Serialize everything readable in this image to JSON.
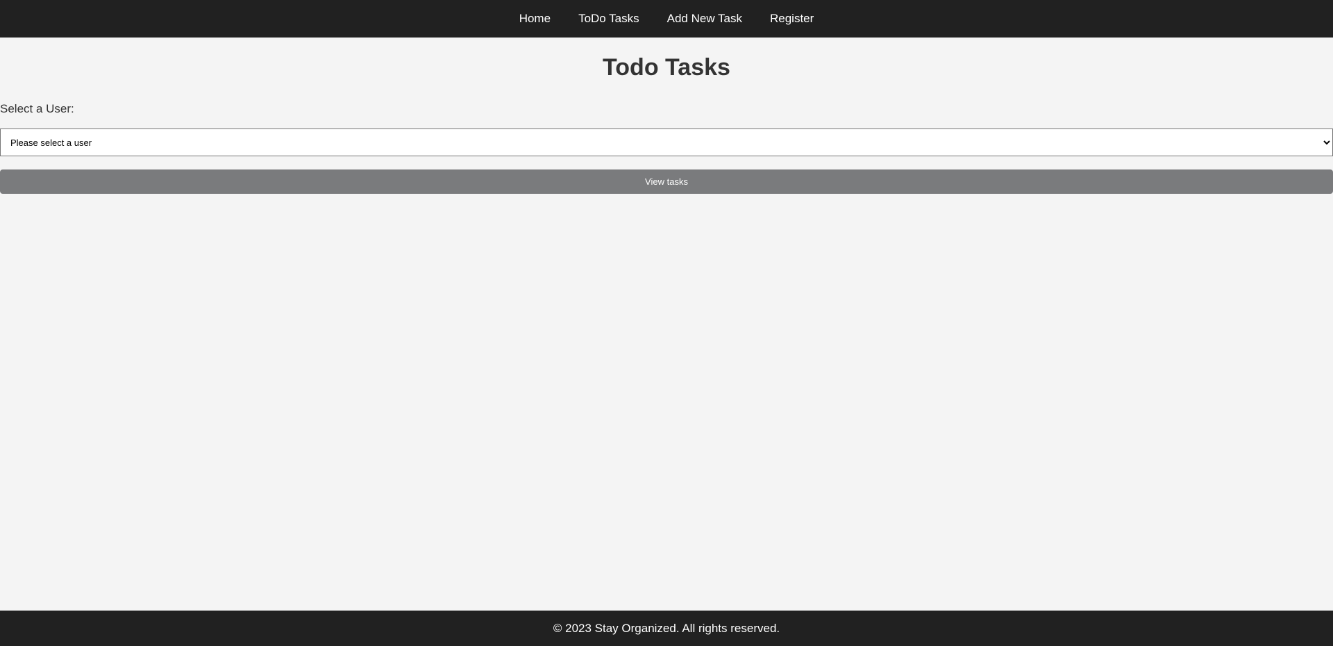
{
  "nav": {
    "items": [
      {
        "label": "Home"
      },
      {
        "label": "ToDo Tasks"
      },
      {
        "label": "Add New Task"
      },
      {
        "label": "Register"
      }
    ]
  },
  "main": {
    "title": "Todo Tasks",
    "select_label": "Select a User:",
    "select_value": "Please select a user",
    "view_button_label": "View tasks"
  },
  "footer": {
    "text": "© 2023 Stay Organized. All rights reserved."
  },
  "colors": {
    "navbar_bg": "#212121",
    "page_bg": "#f4f4f4",
    "button_bg": "#7a7b7d",
    "heading_text": "#333333"
  }
}
